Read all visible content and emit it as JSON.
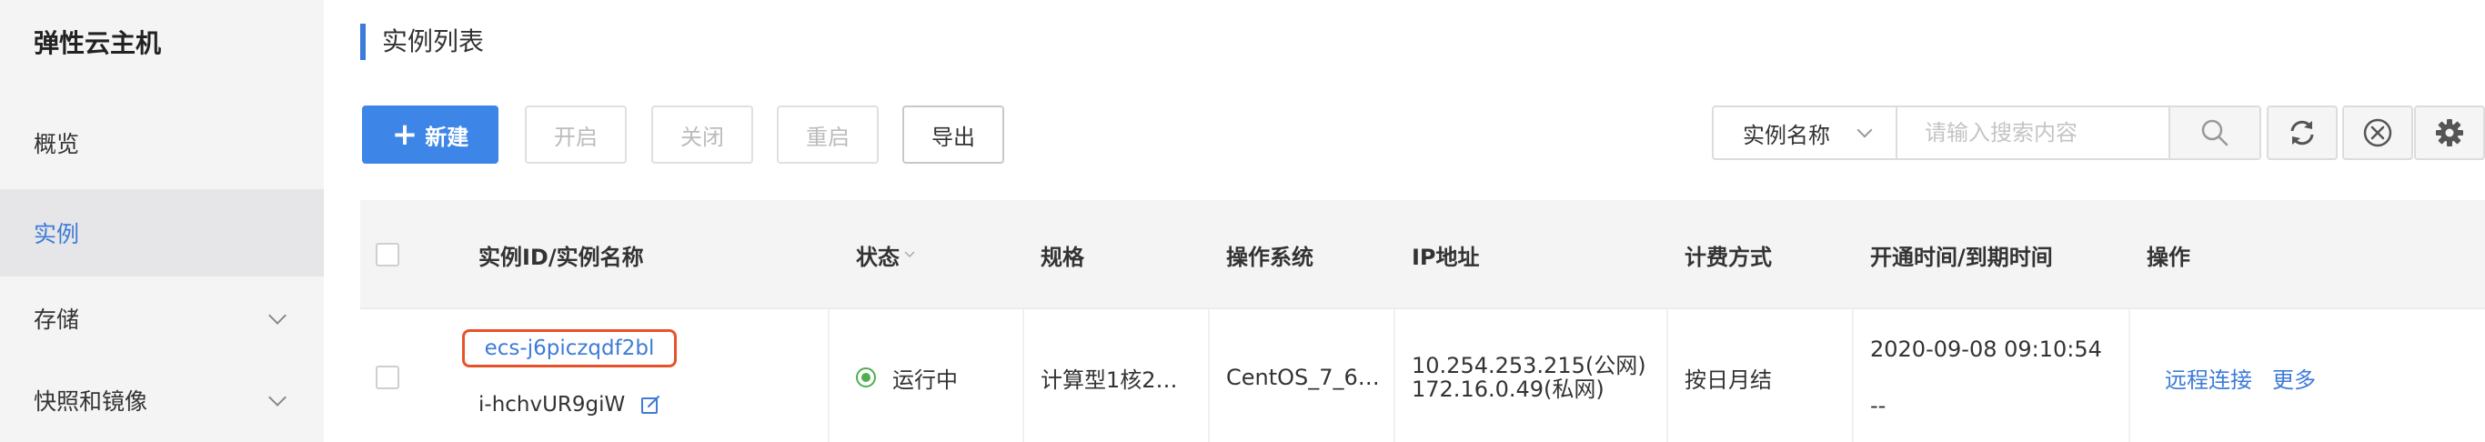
{
  "sidebar": {
    "title": "弹性云主机",
    "items": [
      {
        "label": "概览"
      },
      {
        "label": "实例"
      },
      {
        "label": "存储"
      },
      {
        "label": "快照和镜像"
      }
    ]
  },
  "header": {
    "title": "实例列表"
  },
  "toolbar": {
    "new_label": "新建",
    "new_plus": "+",
    "start_label": "开启",
    "close_label": "关闭",
    "restart_label": "重启",
    "export_label": "导出"
  },
  "search": {
    "field": "实例名称",
    "placeholder": "请输入搜索内容"
  },
  "table": {
    "headers": {
      "id_name": "实例ID/实例名称",
      "status": "状态",
      "spec": "规格",
      "os": "操作系统",
      "ip": "IP地址",
      "billing": "计费方式",
      "time": "开通时间/到期时间",
      "actions": "操作"
    },
    "rows": [
      {
        "name": "ecs-j6piczqdf2bl",
        "id": "i-hchvUR9giW",
        "status": "运行中",
        "spec": "计算型1核2…",
        "os": "CentOS_7_6…",
        "ip_public": "10.254.253.215(公网)",
        "ip_private": "172.16.0.49(私网)",
        "billing": "按日月结",
        "open_time": "2020-09-08 09:10:54",
        "expire_time": "--",
        "action_connect": "远程连接",
        "action_more": "更多"
      }
    ]
  },
  "colors": {
    "accent": "#3d85e6",
    "link": "#3d7bd8",
    "highlight": "#e8522a",
    "running": "#4caf50"
  }
}
